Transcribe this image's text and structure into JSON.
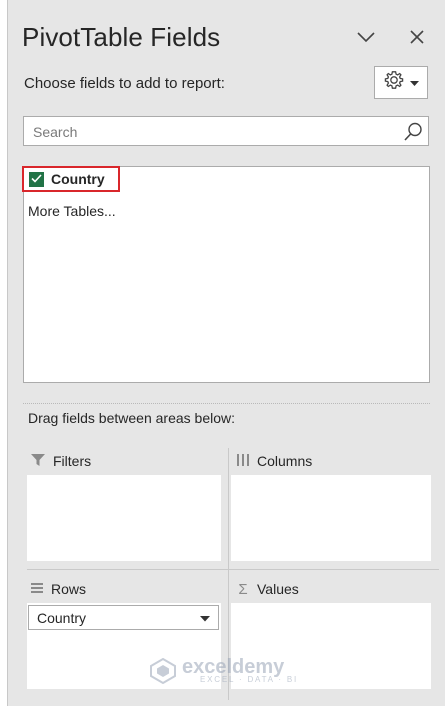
{
  "panel": {
    "title": "PivotTable Fields",
    "subtitle": "Choose fields to add to report:"
  },
  "search": {
    "placeholder": "Search"
  },
  "fields": {
    "items": [
      {
        "label": "Country",
        "checked": true
      }
    ],
    "more_tables": "More Tables..."
  },
  "areas": {
    "instruction": "Drag fields between areas below:",
    "filters": {
      "label": "Filters"
    },
    "columns": {
      "label": "Columns"
    },
    "rows": {
      "label": "Rows",
      "items": [
        "Country"
      ]
    },
    "values": {
      "label": "Values"
    }
  },
  "watermark": {
    "name": "exceldemy",
    "tagline": "EXCEL · DATA · BI"
  },
  "colors": {
    "checkbox": "#217346",
    "highlight": "#d9262b"
  },
  "icons": [
    "chevron-down-icon",
    "close-icon",
    "gear-icon",
    "caret-down-icon",
    "search-icon",
    "check-icon",
    "filter-icon",
    "columns-icon",
    "rows-icon",
    "sigma-icon"
  ]
}
